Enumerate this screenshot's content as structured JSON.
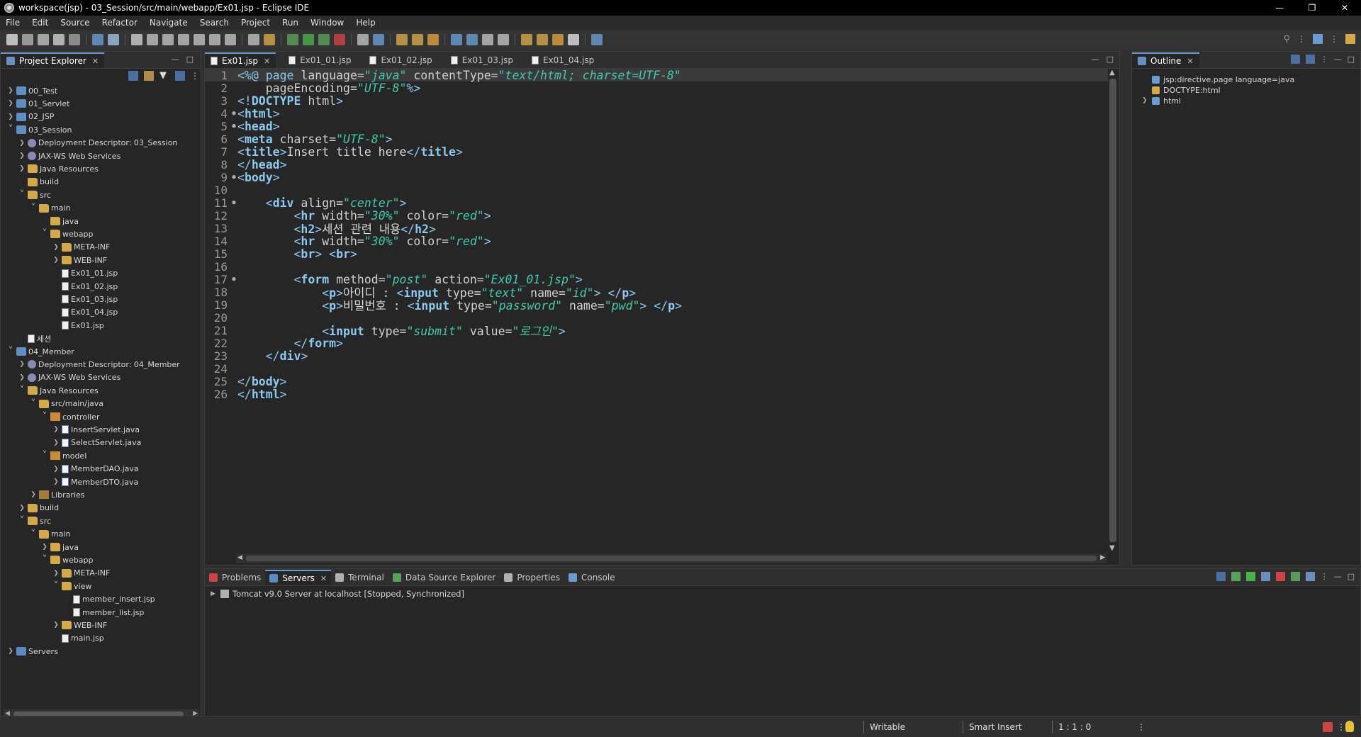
{
  "window": {
    "title": "workspace(jsp) - 03_Session/src/main/webapp/Ex01.jsp - Eclipse IDE"
  },
  "menu": {
    "items": [
      "File",
      "Edit",
      "Source",
      "Refactor",
      "Navigate",
      "Search",
      "Project",
      "Run",
      "Window",
      "Help"
    ]
  },
  "project_explorer": {
    "tab_label": "Project Explorer",
    "tree": [
      {
        "label": "00_Test",
        "depth": 0,
        "expander": "collapsed",
        "icon": "project-icon"
      },
      {
        "label": "01_Servlet",
        "depth": 0,
        "expander": "collapsed",
        "icon": "project-icon"
      },
      {
        "label": "02_JSP",
        "depth": 0,
        "expander": "collapsed",
        "icon": "project-icon"
      },
      {
        "label": "03_Session",
        "depth": 0,
        "expander": "expanded",
        "icon": "project-icon"
      },
      {
        "label": "Deployment Descriptor: 03_Session",
        "depth": 1,
        "expander": "collapsed",
        "icon": "deployment-descriptor-icon"
      },
      {
        "label": "JAX-WS Web Services",
        "depth": 1,
        "expander": "collapsed",
        "icon": "web-services-icon"
      },
      {
        "label": "Java Resources",
        "depth": 1,
        "expander": "collapsed",
        "icon": "java-resources-icon"
      },
      {
        "label": "build",
        "depth": 1,
        "expander": "none",
        "icon": "folder-icon"
      },
      {
        "label": "src",
        "depth": 1,
        "expander": "expanded",
        "icon": "folder-icon"
      },
      {
        "label": "main",
        "depth": 2,
        "expander": "expanded",
        "icon": "folder-icon"
      },
      {
        "label": "java",
        "depth": 3,
        "expander": "none",
        "icon": "folder-icon"
      },
      {
        "label": "webapp",
        "depth": 3,
        "expander": "expanded",
        "icon": "folder-icon"
      },
      {
        "label": "META-INF",
        "depth": 4,
        "expander": "collapsed",
        "icon": "folder-icon"
      },
      {
        "label": "WEB-INF",
        "depth": 4,
        "expander": "collapsed",
        "icon": "folder-icon"
      },
      {
        "label": "Ex01_01.jsp",
        "depth": 4,
        "expander": "none",
        "icon": "jsp-file-icon"
      },
      {
        "label": "Ex01_02.jsp",
        "depth": 4,
        "expander": "none",
        "icon": "jsp-file-icon"
      },
      {
        "label": "Ex01_03.jsp",
        "depth": 4,
        "expander": "none",
        "icon": "jsp-file-icon"
      },
      {
        "label": "Ex01_04.jsp",
        "depth": 4,
        "expander": "none",
        "icon": "jsp-file-icon"
      },
      {
        "label": "Ex01.jsp",
        "depth": 4,
        "expander": "none",
        "icon": "jsp-file-icon"
      },
      {
        "label": "세션",
        "depth": 1,
        "expander": "none",
        "icon": "file-icon"
      },
      {
        "label": "04_Member",
        "depth": 0,
        "expander": "expanded",
        "icon": "project-icon"
      },
      {
        "label": "Deployment Descriptor: 04_Member",
        "depth": 1,
        "expander": "collapsed",
        "icon": "deployment-descriptor-icon"
      },
      {
        "label": "JAX-WS Web Services",
        "depth": 1,
        "expander": "collapsed",
        "icon": "web-services-icon"
      },
      {
        "label": "Java Resources",
        "depth": 1,
        "expander": "expanded",
        "icon": "java-resources-icon"
      },
      {
        "label": "src/main/java",
        "depth": 2,
        "expander": "expanded",
        "icon": "source-folder-icon"
      },
      {
        "label": "controller",
        "depth": 3,
        "expander": "expanded",
        "icon": "package-icon"
      },
      {
        "label": "InsertServlet.java",
        "depth": 4,
        "expander": "collapsed",
        "icon": "java-file-icon"
      },
      {
        "label": "SelectServlet.java",
        "depth": 4,
        "expander": "collapsed",
        "icon": "java-file-icon"
      },
      {
        "label": "model",
        "depth": 3,
        "expander": "expanded",
        "icon": "package-icon"
      },
      {
        "label": "MemberDAO.java",
        "depth": 4,
        "expander": "collapsed",
        "icon": "java-file-icon"
      },
      {
        "label": "MemberDTO.java",
        "depth": 4,
        "expander": "collapsed",
        "icon": "java-file-icon"
      },
      {
        "label": "Libraries",
        "depth": 2,
        "expander": "collapsed",
        "icon": "libraries-icon"
      },
      {
        "label": "build",
        "depth": 1,
        "expander": "collapsed",
        "icon": "folder-icon"
      },
      {
        "label": "src",
        "depth": 1,
        "expander": "expanded",
        "icon": "folder-icon"
      },
      {
        "label": "main",
        "depth": 2,
        "expander": "expanded",
        "icon": "folder-icon"
      },
      {
        "label": "java",
        "depth": 3,
        "expander": "collapsed",
        "icon": "folder-icon"
      },
      {
        "label": "webapp",
        "depth": 3,
        "expander": "expanded",
        "icon": "folder-icon"
      },
      {
        "label": "META-INF",
        "depth": 4,
        "expander": "collapsed",
        "icon": "folder-icon"
      },
      {
        "label": "view",
        "depth": 4,
        "expander": "expanded",
        "icon": "folder-icon"
      },
      {
        "label": "member_insert.jsp",
        "depth": 5,
        "expander": "none",
        "icon": "jsp-file-icon"
      },
      {
        "label": "member_list.jsp",
        "depth": 5,
        "expander": "none",
        "icon": "jsp-file-icon"
      },
      {
        "label": "WEB-INF",
        "depth": 4,
        "expander": "collapsed",
        "icon": "folder-icon"
      },
      {
        "label": "main.jsp",
        "depth": 4,
        "expander": "none",
        "icon": "jsp-file-icon"
      },
      {
        "label": "Servers",
        "depth": 0,
        "expander": "collapsed",
        "icon": "servers-icon"
      }
    ]
  },
  "editor": {
    "tabs": [
      {
        "label": "Ex01.jsp",
        "active": true
      },
      {
        "label": "Ex01_01.jsp",
        "active": false
      },
      {
        "label": "Ex01_02.jsp",
        "active": false
      },
      {
        "label": "Ex01_03.jsp",
        "active": false
      },
      {
        "label": "Ex01_04.jsp",
        "active": false
      }
    ],
    "lines": [
      {
        "n": "1",
        "fold": "",
        "tokens": [
          [
            "punct",
            "<%@ "
          ],
          [
            "dir",
            "page "
          ],
          [
            "attr",
            "language="
          ],
          [
            "val",
            "\"java\""
          ],
          [
            "attr",
            " contentType="
          ],
          [
            "val",
            "\"text/html; charset=UTF-8\""
          ]
        ]
      },
      {
        "n": "2",
        "fold": "",
        "tokens": [
          [
            "attr",
            "    pageEncoding="
          ],
          [
            "val",
            "\"UTF-8\""
          ],
          [
            "punct",
            "%>"
          ]
        ]
      },
      {
        "n": "3",
        "fold": "",
        "tokens": [
          [
            "punct",
            "<!"
          ],
          [
            "tag",
            "DOCTYPE"
          ],
          [
            "attr",
            " html"
          ],
          [
            "punct",
            ">"
          ]
        ]
      },
      {
        "n": "4",
        "fold": "fold",
        "tokens": [
          [
            "punct",
            "<"
          ],
          [
            "tag",
            "html"
          ],
          [
            "punct",
            ">"
          ]
        ]
      },
      {
        "n": "5",
        "fold": "fold",
        "tokens": [
          [
            "punct",
            "<"
          ],
          [
            "tag",
            "head"
          ],
          [
            "punct",
            ">"
          ]
        ]
      },
      {
        "n": "6",
        "fold": "",
        "tokens": [
          [
            "punct",
            "<"
          ],
          [
            "tag",
            "meta"
          ],
          [
            "attr",
            " charset="
          ],
          [
            "val",
            "\"UTF-8\""
          ],
          [
            "punct",
            ">"
          ]
        ]
      },
      {
        "n": "7",
        "fold": "",
        "tokens": [
          [
            "punct",
            "<"
          ],
          [
            "tag",
            "title"
          ],
          [
            "punct",
            ">"
          ],
          [
            "src",
            "Insert title here"
          ],
          [
            "punct",
            "</"
          ],
          [
            "tag",
            "title"
          ],
          [
            "punct",
            ">"
          ]
        ]
      },
      {
        "n": "8",
        "fold": "",
        "tokens": [
          [
            "punct",
            "</"
          ],
          [
            "tag",
            "head"
          ],
          [
            "punct",
            ">"
          ]
        ]
      },
      {
        "n": "9",
        "fold": "fold",
        "tokens": [
          [
            "punct",
            "<"
          ],
          [
            "tag",
            "body"
          ],
          [
            "punct",
            ">"
          ]
        ]
      },
      {
        "n": "10",
        "fold": "",
        "tokens": []
      },
      {
        "n": "11",
        "fold": "fold",
        "tokens": [
          [
            "src",
            "    "
          ],
          [
            "punct",
            "<"
          ],
          [
            "tag",
            "div"
          ],
          [
            "attr",
            " align="
          ],
          [
            "val",
            "\"center\""
          ],
          [
            "punct",
            ">"
          ]
        ]
      },
      {
        "n": "12",
        "fold": "",
        "tokens": [
          [
            "src",
            "        "
          ],
          [
            "punct",
            "<"
          ],
          [
            "tag",
            "hr"
          ],
          [
            "attr",
            " width="
          ],
          [
            "val",
            "\"30%\""
          ],
          [
            "attr",
            " color="
          ],
          [
            "val",
            "\"red\""
          ],
          [
            "punct",
            ">"
          ]
        ]
      },
      {
        "n": "13",
        "fold": "",
        "tokens": [
          [
            "src",
            "        "
          ],
          [
            "punct",
            "<"
          ],
          [
            "tag",
            "h2"
          ],
          [
            "punct",
            ">"
          ],
          [
            "src",
            "세션 관련 내용"
          ],
          [
            "punct",
            "</"
          ],
          [
            "tag",
            "h2"
          ],
          [
            "punct",
            ">"
          ]
        ]
      },
      {
        "n": "14",
        "fold": "",
        "tokens": [
          [
            "src",
            "        "
          ],
          [
            "punct",
            "<"
          ],
          [
            "tag",
            "hr"
          ],
          [
            "attr",
            " width="
          ],
          [
            "val",
            "\"30%\""
          ],
          [
            "attr",
            " color="
          ],
          [
            "val",
            "\"red\""
          ],
          [
            "punct",
            ">"
          ]
        ]
      },
      {
        "n": "15",
        "fold": "",
        "tokens": [
          [
            "src",
            "        "
          ],
          [
            "punct",
            "<"
          ],
          [
            "tag",
            "br"
          ],
          [
            "punct",
            "> <"
          ],
          [
            "tag",
            "br"
          ],
          [
            "punct",
            ">"
          ]
        ]
      },
      {
        "n": "16",
        "fold": "",
        "tokens": []
      },
      {
        "n": "17",
        "fold": "fold",
        "tokens": [
          [
            "src",
            "        "
          ],
          [
            "punct",
            "<"
          ],
          [
            "tag",
            "form"
          ],
          [
            "attr",
            " method="
          ],
          [
            "val",
            "\"post\""
          ],
          [
            "attr",
            " action="
          ],
          [
            "val",
            "\"Ex01_01.jsp\""
          ],
          [
            "punct",
            ">"
          ]
        ]
      },
      {
        "n": "18",
        "fold": "",
        "tokens": [
          [
            "src",
            "            "
          ],
          [
            "punct",
            "<"
          ],
          [
            "tag",
            "p"
          ],
          [
            "punct",
            ">"
          ],
          [
            "src",
            "아이디 : "
          ],
          [
            "punct",
            "<"
          ],
          [
            "tag",
            "input"
          ],
          [
            "attr",
            " type="
          ],
          [
            "val",
            "\"text\""
          ],
          [
            "attr",
            " name="
          ],
          [
            "val",
            "\"id\""
          ],
          [
            "punct",
            "> </"
          ],
          [
            "tag",
            "p"
          ],
          [
            "punct",
            ">"
          ]
        ]
      },
      {
        "n": "19",
        "fold": "",
        "tokens": [
          [
            "src",
            "            "
          ],
          [
            "punct",
            "<"
          ],
          [
            "tag",
            "p"
          ],
          [
            "punct",
            ">"
          ],
          [
            "src",
            "비밀번호 : "
          ],
          [
            "punct",
            "<"
          ],
          [
            "tag",
            "input"
          ],
          [
            "attr",
            " type="
          ],
          [
            "val",
            "\"password\""
          ],
          [
            "attr",
            " name="
          ],
          [
            "val",
            "\"pwd\""
          ],
          [
            "punct",
            "> </"
          ],
          [
            "tag",
            "p"
          ],
          [
            "punct",
            ">"
          ]
        ]
      },
      {
        "n": "20",
        "fold": "",
        "tokens": []
      },
      {
        "n": "21",
        "fold": "",
        "tokens": [
          [
            "src",
            "            "
          ],
          [
            "punct",
            "<"
          ],
          [
            "tag",
            "input"
          ],
          [
            "attr",
            " type="
          ],
          [
            "val",
            "\"submit\""
          ],
          [
            "attr",
            " value="
          ],
          [
            "val",
            "\"로그인\""
          ],
          [
            "punct",
            ">"
          ]
        ]
      },
      {
        "n": "22",
        "fold": "",
        "tokens": [
          [
            "src",
            "        "
          ],
          [
            "punct",
            "</"
          ],
          [
            "tag",
            "form"
          ],
          [
            "punct",
            ">"
          ]
        ]
      },
      {
        "n": "23",
        "fold": "",
        "tokens": [
          [
            "src",
            "    "
          ],
          [
            "punct",
            "</"
          ],
          [
            "tag",
            "div"
          ],
          [
            "punct",
            ">"
          ]
        ]
      },
      {
        "n": "24",
        "fold": "",
        "tokens": []
      },
      {
        "n": "25",
        "fold": "",
        "tokens": [
          [
            "punct",
            "</"
          ],
          [
            "tag",
            "body"
          ],
          [
            "punct",
            ">"
          ]
        ]
      },
      {
        "n": "26",
        "fold": "",
        "tokens": [
          [
            "punct",
            "</"
          ],
          [
            "tag",
            "html"
          ],
          [
            "punct",
            ">"
          ]
        ]
      }
    ]
  },
  "outline": {
    "tab_label": "Outline",
    "items": [
      {
        "label": "jsp:directive.page language=java",
        "expander": "none",
        "icon": "directive-icon"
      },
      {
        "label": "DOCTYPE:html",
        "expander": "none",
        "icon": "doctype-icon"
      },
      {
        "label": "html",
        "expander": "collapsed",
        "icon": "html-element-icon"
      }
    ]
  },
  "bottom": {
    "tabs": [
      {
        "label": "Problems",
        "active": false,
        "icon": "problems-icon"
      },
      {
        "label": "Servers",
        "active": true,
        "icon": "servers-icon"
      },
      {
        "label": "Terminal",
        "active": false,
        "icon": "terminal-icon"
      },
      {
        "label": "Data Source Explorer",
        "active": false,
        "icon": "data-source-icon"
      },
      {
        "label": "Properties",
        "active": false,
        "icon": "properties-icon"
      },
      {
        "label": "Console",
        "active": false,
        "icon": "console-icon"
      }
    ],
    "server_entry": "Tomcat v9.0 Server at localhost  [Stopped, Synchronized]"
  },
  "statusbar": {
    "writable": "Writable",
    "insert_mode": "Smart Insert",
    "position": "1 : 1 : 0"
  },
  "colors": {
    "tag": "#8cc8f0",
    "value": "#43c9a8",
    "active_tab_accent": "#6b9bd1",
    "background": "#262626"
  }
}
